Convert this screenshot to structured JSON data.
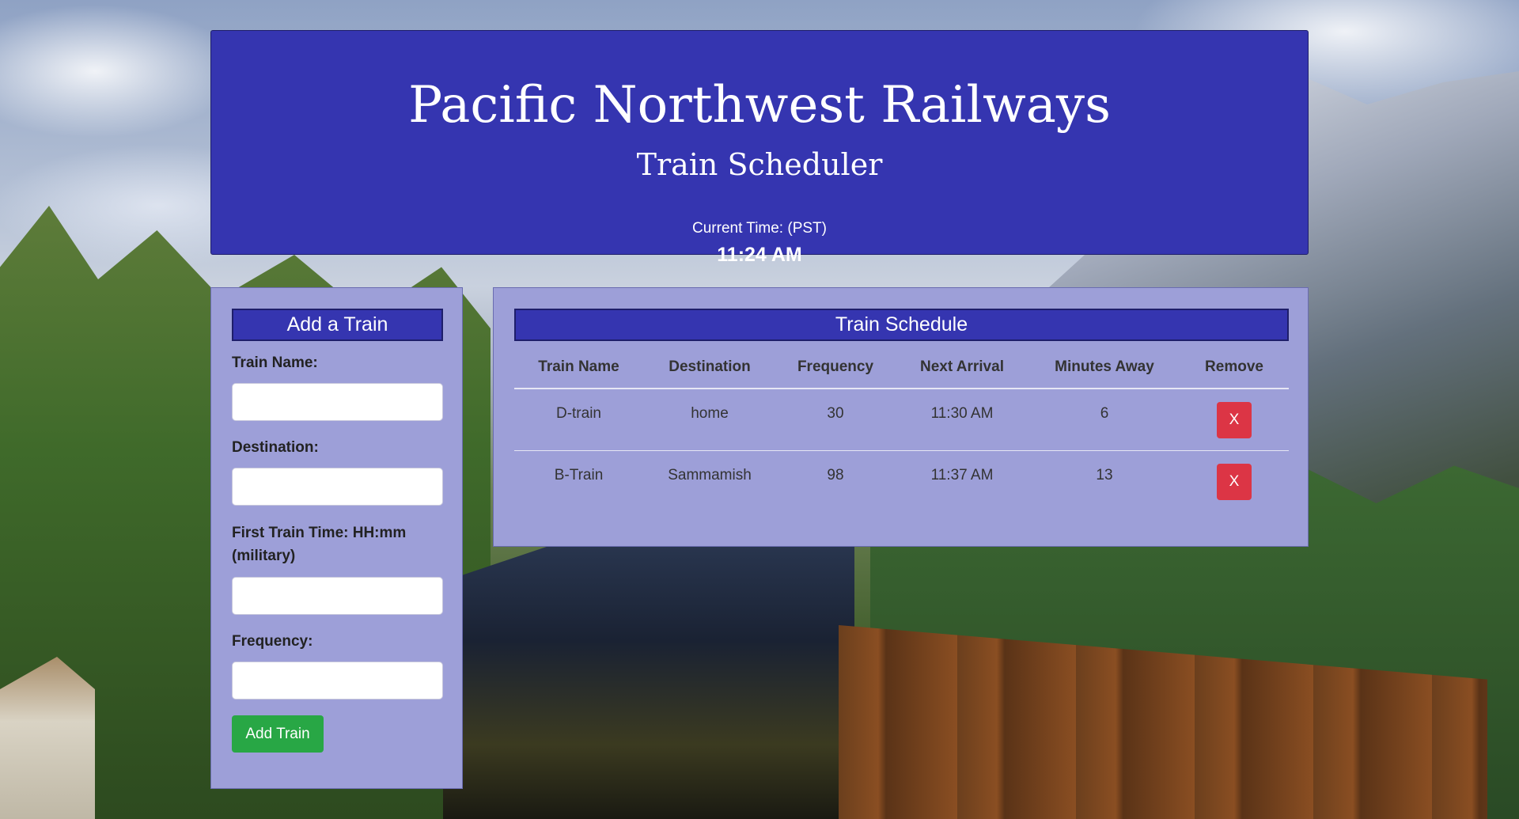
{
  "header": {
    "title": "Pacific Northwest Railways",
    "subtitle": "Train Scheduler",
    "time_label": "Current Time: (PST)",
    "current_time": "11:24 AM"
  },
  "add_train": {
    "heading": "Add a Train",
    "train_name_label": "Train Name:",
    "train_name_value": "",
    "destination_label": "Destination:",
    "destination_value": "",
    "first_time_label": "First Train Time: HH:mm (military)",
    "first_time_value": "",
    "frequency_label": "Frequency:",
    "frequency_value": "",
    "submit_label": "Add Train"
  },
  "schedule": {
    "heading": "Train Schedule",
    "columns": [
      "Train Name",
      "Destination",
      "Frequency",
      "Next Arrival",
      "Minutes Away",
      "Remove"
    ],
    "rows": [
      {
        "name": "D-train",
        "destination": "home",
        "frequency": "30",
        "next_arrival": "11:30 AM",
        "minutes_away": "6",
        "remove_label": "X"
      },
      {
        "name": "B-Train",
        "destination": "Sammamish",
        "frequency": "98",
        "next_arrival": "11:37 AM",
        "minutes_away": "13",
        "remove_label": "X"
      }
    ]
  },
  "colors": {
    "header_bg": "#3535b0",
    "panel_bg": "#9d9fd8",
    "add_button": "#28a745",
    "remove_button": "#dc3545"
  }
}
